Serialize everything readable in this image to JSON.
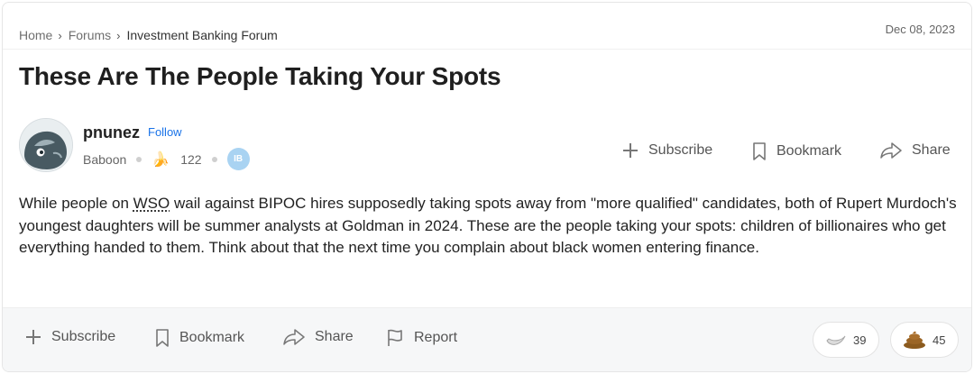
{
  "breadcrumb": {
    "home": "Home",
    "forums": "Forums",
    "current": "Investment Banking Forum"
  },
  "date": "Dec 08, 2023",
  "title": "These Are The People Taking Your Spots",
  "author": {
    "name": "pnunez",
    "follow": "Follow",
    "rank": "Baboon",
    "bananas": "122",
    "badge": "IB"
  },
  "actions": {
    "subscribe": "Subscribe",
    "bookmark": "Bookmark",
    "share": "Share",
    "report": "Report"
  },
  "post": {
    "part1": "While people on ",
    "wso": "WSO",
    "part2": " wail against BIPOC hires supposedly taking spots away from \"more qualified\" candidates, both of Rupert Murdoch's youngest daughters will be summer analysts at Goldman in 2024. These are the people taking your spots: children of billionaires who get everything handed to them. Think about that the next time you complain about black women entering finance."
  },
  "reactions": {
    "silver_banana": "39",
    "monkey_poo": "45"
  }
}
